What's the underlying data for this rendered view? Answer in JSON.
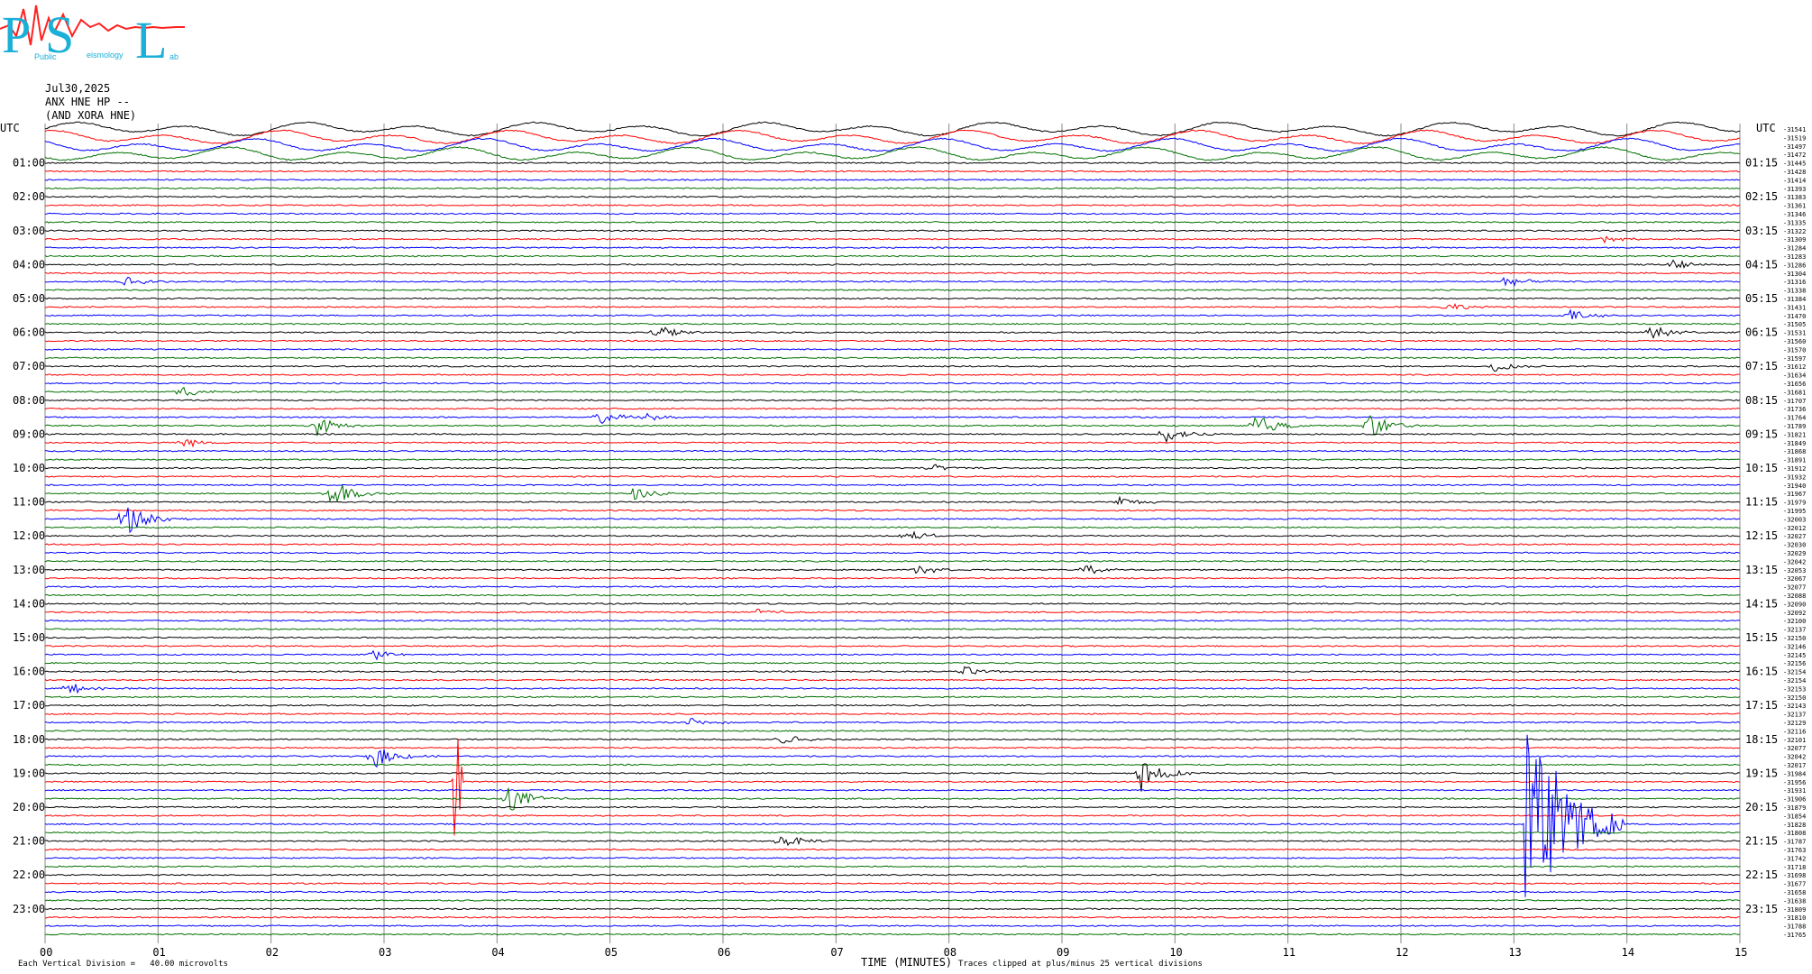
{
  "logo": {
    "letters": [
      "P",
      "S",
      "L"
    ],
    "small_text": [
      "Public",
      "eismology",
      "ab"
    ]
  },
  "header": {
    "date": "Jul30,2025",
    "station": "ANX HNE HP --",
    "network": "(AND XORA HNE)"
  },
  "left_axis_label": "UTC",
  "right_axis_label": "UTC",
  "left_hours": [
    "01:00",
    "02:00",
    "03:00",
    "04:00",
    "05:00",
    "06:00",
    "07:00",
    "08:00",
    "09:00",
    "10:00",
    "11:00",
    "12:00",
    "13:00",
    "14:00",
    "15:00",
    "16:00",
    "17:00",
    "18:00",
    "19:00",
    "20:00",
    "21:00",
    "22:00",
    "23:00"
  ],
  "right_hours": [
    "01:15",
    "02:15",
    "03:15",
    "04:15",
    "05:15",
    "06:15",
    "07:15",
    "08:15",
    "09:15",
    "10:15",
    "11:15",
    "12:15",
    "13:15",
    "14:15",
    "15:15",
    "16:15",
    "17:15",
    "18:15",
    "19:15",
    "20:15",
    "21:15",
    "22:15",
    "23:15"
  ],
  "footer": {
    "scale_note": "Each Vertical Division =   40.00 microvolts",
    "xlabel": "TIME (MINUTES)",
    "clip_note": "Traces clipped at plus/minus 25 vertical divisions"
  },
  "colors": {
    "trace_cycle": [
      "#000000",
      "#ff0000",
      "#0000ff",
      "#007000"
    ],
    "grid": "#888888",
    "logo": "#1ab0d8",
    "logo_wave": "#ff2020"
  },
  "chart_data": {
    "type": "line",
    "title": "",
    "xlabel": "TIME (MINUTES)",
    "ylabel": "UTC",
    "xlim": [
      0,
      15
    ],
    "x_ticks": [
      "00",
      "01",
      "02",
      "03",
      "04",
      "05",
      "06",
      "07",
      "08",
      "09",
      "10",
      "11",
      "12",
      "13",
      "14",
      "15"
    ],
    "rows_per_hour": 4,
    "row_count": 96,
    "right_values": [
      "-31541",
      "-31519",
      "-31497",
      "-31472",
      "-31445",
      "-31428",
      "-31414",
      "-31393",
      "-31383",
      "-31361",
      "-31346",
      "-31335",
      "-31322",
      "-31309",
      "-31284",
      "-31283",
      "-31286",
      "-31304",
      "-31316",
      "-31338",
      "-31384",
      "-31431",
      "-31470",
      "-31505",
      "-31531",
      "-31560",
      "-31570",
      "-31597",
      "-31612",
      "-31634",
      "-31656",
      "-31681",
      "-31707",
      "-31736",
      "-31764",
      "-31789",
      "-31821",
      "-31849",
      "-31868",
      "-31891",
      "-31912",
      "-31932",
      "-31940",
      "-31967",
      "-31979",
      "-31995",
      "-32003",
      "-32012",
      "-32027",
      "-32030",
      "-32029",
      "-32042",
      "-32053",
      "-32067",
      "-32077",
      "-32088",
      "-32090",
      "-32092",
      "-32100",
      "-32137",
      "-32150",
      "-32146",
      "-32145",
      "-32156",
      "-32154",
      "-32154",
      "-32153",
      "-32150",
      "-32143",
      "-32137",
      "-32129",
      "-32116",
      "-32101",
      "-32077",
      "-32042",
      "-32017",
      "-31984",
      "-31956",
      "-31931",
      "-31906",
      "-31879",
      "-31854",
      "-31828",
      "-31808",
      "-31787",
      "-31763",
      "-31742",
      "-31718",
      "-31698",
      "-31677",
      "-31658",
      "-31638",
      "-31809",
      "-31810",
      "-31788",
      "-31765"
    ],
    "events": [
      {
        "row": 13,
        "minute": 13.8,
        "amp": 0.6
      },
      {
        "row": 16,
        "minute": 14.4,
        "amp": 0.8
      },
      {
        "row": 18,
        "minute": 0.7,
        "amp": 0.9
      },
      {
        "row": 18,
        "minute": 12.9,
        "amp": 1.0
      },
      {
        "row": 21,
        "minute": 12.4,
        "amp": 0.8
      },
      {
        "row": 22,
        "minute": 13.5,
        "amp": 1.0
      },
      {
        "row": 24,
        "minute": 5.4,
        "amp": 1.4
      },
      {
        "row": 24,
        "minute": 14.2,
        "amp": 1.2
      },
      {
        "row": 28,
        "minute": 12.8,
        "amp": 1.0
      },
      {
        "row": 31,
        "minute": 1.2,
        "amp": 1.0
      },
      {
        "row": 34,
        "minute": 4.9,
        "amp": 1.2
      },
      {
        "row": 34,
        "minute": 5.3,
        "amp": 0.8
      },
      {
        "row": 35,
        "minute": 2.4,
        "amp": 1.6
      },
      {
        "row": 35,
        "minute": 10.7,
        "amp": 2.0
      },
      {
        "row": 35,
        "minute": 11.7,
        "amp": 2.4
      },
      {
        "row": 36,
        "minute": 9.9,
        "amp": 1.6
      },
      {
        "row": 37,
        "minute": 1.2,
        "amp": 1.0
      },
      {
        "row": 40,
        "minute": 7.8,
        "amp": 0.8
      },
      {
        "row": 43,
        "minute": 2.5,
        "amp": 3.0
      },
      {
        "row": 43,
        "minute": 5.2,
        "amp": 1.0
      },
      {
        "row": 44,
        "minute": 9.5,
        "amp": 1.0
      },
      {
        "row": 46,
        "minute": 0.7,
        "amp": 3.0
      },
      {
        "row": 48,
        "minute": 7.6,
        "amp": 1.0
      },
      {
        "row": 52,
        "minute": 9.2,
        "amp": 1.0
      },
      {
        "row": 52,
        "minute": 7.7,
        "amp": 1.0
      },
      {
        "row": 57,
        "minute": 6.3,
        "amp": 0.6
      },
      {
        "row": 62,
        "minute": 2.9,
        "amp": 1.0
      },
      {
        "row": 64,
        "minute": 8.1,
        "amp": 1.0
      },
      {
        "row": 66,
        "minute": 0.2,
        "amp": 1.0
      },
      {
        "row": 70,
        "minute": 5.7,
        "amp": 0.8
      },
      {
        "row": 72,
        "minute": 6.5,
        "amp": 1.0
      },
      {
        "row": 74,
        "minute": 2.9,
        "amp": 2.0
      },
      {
        "row": 76,
        "minute": 9.7,
        "amp": 3.0
      },
      {
        "row": 79,
        "minute": 4.1,
        "amp": 2.4
      },
      {
        "row": 84,
        "minute": 6.5,
        "amp": 1.2
      },
      {
        "row": 82,
        "minute": 13.3,
        "amp": 3.0
      }
    ],
    "big_event": {
      "row": 82,
      "minute": 13.1,
      "amp": 14.0
    },
    "green_spike": {
      "row": 77,
      "minute": 3.6,
      "amp": 9.0
    }
  }
}
